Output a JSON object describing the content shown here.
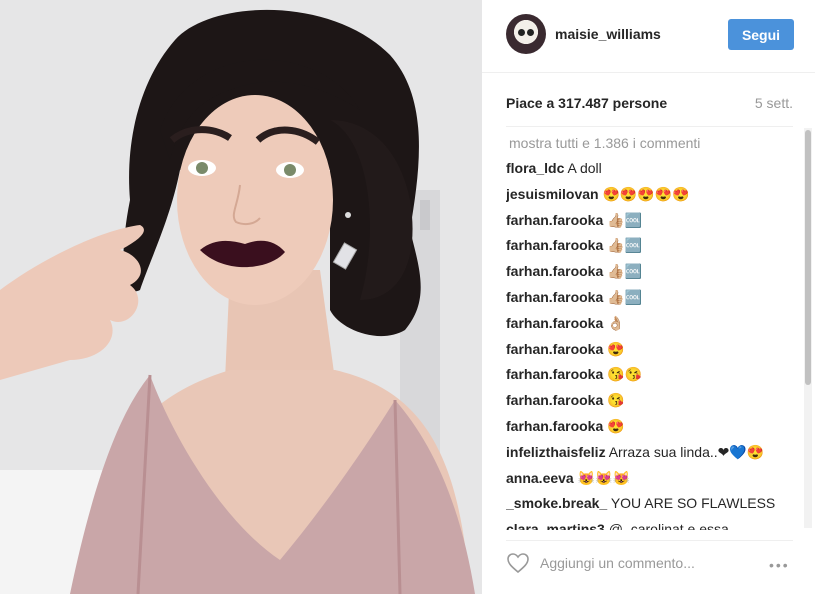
{
  "header": {
    "username": "maisie_williams",
    "follow_label": "Segui"
  },
  "stats": {
    "likes": "Piace a 317.487 persone",
    "time": "5 sett."
  },
  "comments": {
    "more": "mostra tutti e 1.386 i commenti",
    "items": [
      {
        "user": "flora_ldc",
        "text": "A doll"
      },
      {
        "user": "jesuismilovan",
        "text": "😍😍😍😍😍"
      },
      {
        "user": "farhan.farooka",
        "text": "👍🏼🆒"
      },
      {
        "user": "farhan.farooka",
        "text": "👍🏼🆒"
      },
      {
        "user": "farhan.farooka",
        "text": "👍🏼🆒"
      },
      {
        "user": "farhan.farooka",
        "text": "👍🏼🆒"
      },
      {
        "user": "farhan.farooka",
        "text": "👌🏼"
      },
      {
        "user": "farhan.farooka",
        "text": "😍"
      },
      {
        "user": "farhan.farooka",
        "text": "😘😘"
      },
      {
        "user": "farhan.farooka",
        "text": "😘"
      },
      {
        "user": "farhan.farooka",
        "text": "😍"
      },
      {
        "user": "infelizthaisfeliz",
        "text": "Arraza sua linda..❤💙😍"
      },
      {
        "user": "anna.eeva",
        "text": "😻😻😻"
      },
      {
        "user": "_smoke.break_",
        "text": "YOU ARE SO FLAWLESS"
      },
      {
        "user": "clara_martins3",
        "text": "@_carolinat e essa"
      }
    ]
  },
  "footer": {
    "placeholder": "Aggiungi un commento...",
    "more_icon": "•••"
  },
  "icons": {
    "heart": "heart-icon",
    "more": "more-options-icon"
  },
  "colors": {
    "follow_button": "#4b92db",
    "muted_text": "#999999"
  }
}
